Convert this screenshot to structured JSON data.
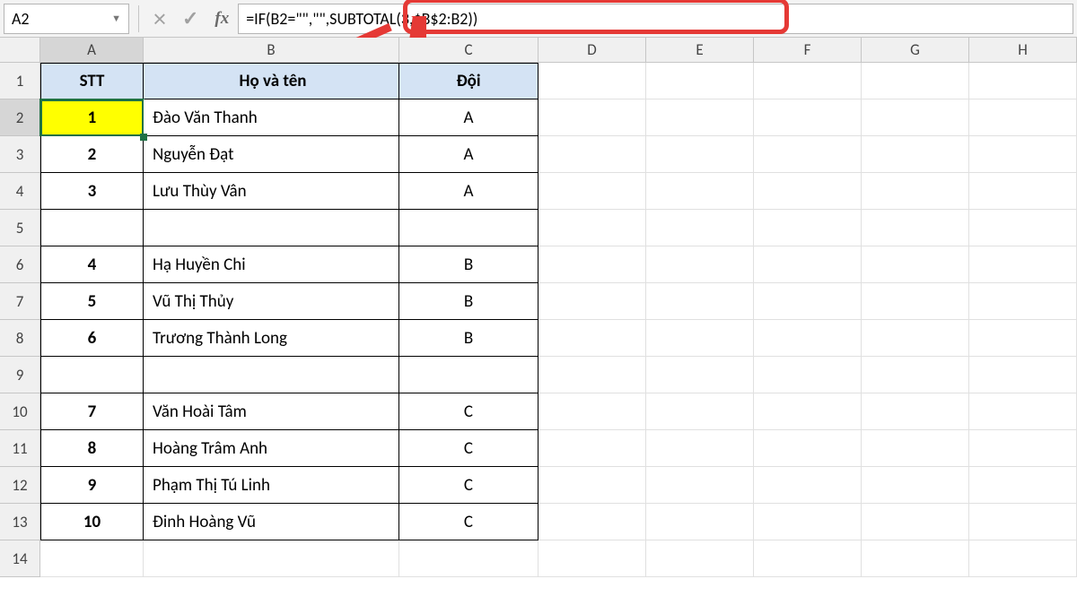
{
  "formula_bar": {
    "name_box_value": "A2",
    "formula_value": "=IF(B2=\"\",\"\",SUBTOTAL(3,$B$2:B2))"
  },
  "columns": [
    "A",
    "B",
    "C",
    "D",
    "E",
    "F",
    "G",
    "H"
  ],
  "headers": {
    "stt": "STT",
    "name": "Họ và tên",
    "team": "Đội"
  },
  "rows": [
    {
      "r": 1,
      "stt": "",
      "name": "",
      "team": "",
      "is_header": true
    },
    {
      "r": 2,
      "stt": "1",
      "name": "Đào Văn Thanh",
      "team": "A"
    },
    {
      "r": 3,
      "stt": "2",
      "name": "Nguyễn Đạt",
      "team": "A"
    },
    {
      "r": 4,
      "stt": "3",
      "name": "Lưu Thùy Vân",
      "team": "A"
    },
    {
      "r": 5,
      "stt": "",
      "name": "",
      "team": ""
    },
    {
      "r": 6,
      "stt": "4",
      "name": "Hạ Huyền Chi",
      "team": "B"
    },
    {
      "r": 7,
      "stt": "5",
      "name": "Vũ Thị Thủy",
      "team": "B"
    },
    {
      "r": 8,
      "stt": "6",
      "name": "Trương Thành Long",
      "team": "B"
    },
    {
      "r": 9,
      "stt": "",
      "name": "",
      "team": ""
    },
    {
      "r": 10,
      "stt": "7",
      "name": "Văn Hoài Tâm",
      "team": "C"
    },
    {
      "r": 11,
      "stt": "8",
      "name": "Hoàng Trâm Anh",
      "team": "C"
    },
    {
      "r": 12,
      "stt": "9",
      "name": "Phạm Thị Tú Linh",
      "team": "C"
    },
    {
      "r": 13,
      "stt": "10",
      "name": "Đinh Hoàng Vũ",
      "team": "C"
    },
    {
      "r": 14,
      "stt": "",
      "name": "",
      "team": "",
      "outside": true
    }
  ],
  "active_cell": "A2",
  "icons": {
    "cancel": "×",
    "confirm": "✓",
    "fx": "fx",
    "dropdown": "▼"
  }
}
